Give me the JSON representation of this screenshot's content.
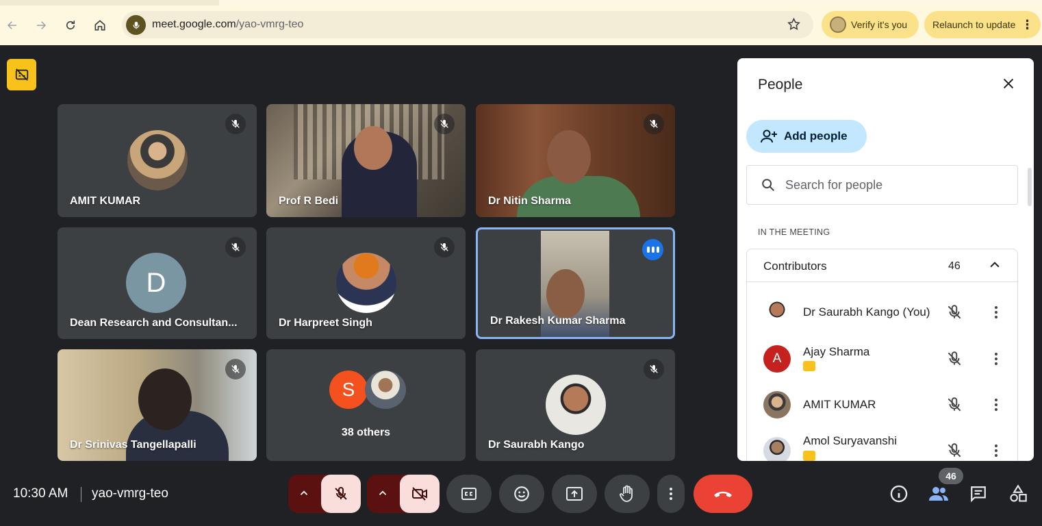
{
  "browser": {
    "url_host": "meet.google.com",
    "url_path": "/yao-vmrg-teo",
    "verify_label": "Verify it's you",
    "relaunch_label": "Relaunch to update"
  },
  "tiles": [
    {
      "name": "AMIT KUMAR",
      "type": "avatar-photo",
      "muted": true
    },
    {
      "name": "Prof R Bedi",
      "type": "video",
      "muted": true
    },
    {
      "name": "Dr Nitin Sharma",
      "type": "video",
      "muted": true
    },
    {
      "name": "Dean Research and Consultan...",
      "type": "avatar-letter",
      "letter": "D",
      "muted": true
    },
    {
      "name": "Dr Harpreet Singh",
      "type": "avatar-photo",
      "muted": true
    },
    {
      "name": "Dr Rakesh Kumar Sharma",
      "type": "video",
      "speaking": true
    },
    {
      "name": "Dr Srinivas Tangellapalli",
      "type": "video",
      "muted": true
    },
    {
      "name": "38 others",
      "type": "others",
      "letter": "S"
    },
    {
      "name": "Dr Saurabh Kango",
      "type": "avatar-photo",
      "muted": true
    }
  ],
  "panel": {
    "title": "People",
    "add_people_label": "Add people",
    "search_placeholder": "Search for people",
    "section_label": "IN THE MEETING",
    "contributors_label": "Contributors",
    "contributors_count": "46",
    "people": [
      {
        "name": "Dr Saurabh Kango (You)",
        "avatar": "photo",
        "has_tag": false
      },
      {
        "name": "Ajay Sharma",
        "avatar": "letter",
        "letter": "A",
        "color": "#c5221f",
        "has_tag": true
      },
      {
        "name": "AMIT KUMAR",
        "avatar": "photo",
        "has_tag": false
      },
      {
        "name": "Amol Suryavanshi",
        "avatar": "photo",
        "has_tag": true
      }
    ]
  },
  "bottom": {
    "time": "10:30 AM",
    "meeting_code": "yao-vmrg-teo",
    "people_count": "46"
  },
  "colors": {
    "accent_blue": "#1a73e8",
    "end_call_red": "#ea4335",
    "caption_yellow": "#f9c21b"
  }
}
